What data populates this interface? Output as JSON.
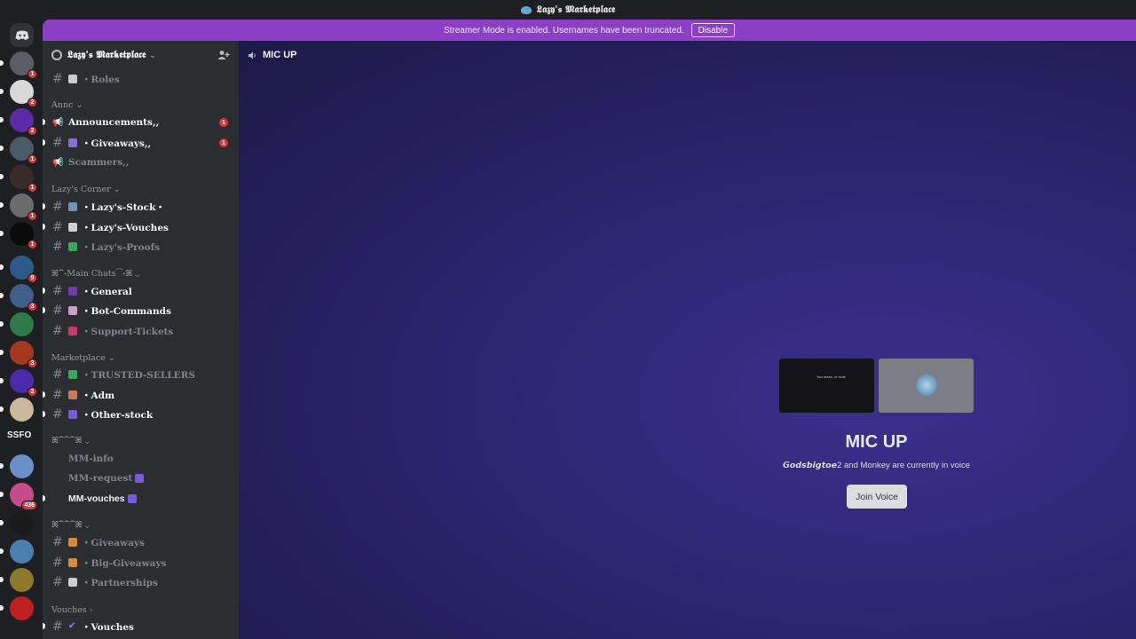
{
  "window": {
    "title": "𝕷𝖆𝖟𝖞'𝖘 𝕸𝖆𝖗𝖐𝖊𝖙𝖕𝖑𝖆𝖈𝖊"
  },
  "banner": {
    "text": "Streamer Mode is enabled. Usernames have been truncated.",
    "button": "Disable"
  },
  "guilds": [
    {
      "badge": "1",
      "color": "#5a5d64"
    },
    {
      "badge": "2",
      "color": "#d9d9d9"
    },
    {
      "badge": "2",
      "color": "#5a2aa8"
    },
    {
      "badge": "1",
      "color": "#4a5a66"
    },
    {
      "badge": "1",
      "color": "#3a2a2a"
    },
    {
      "badge": "1",
      "color": "#6b6b6b"
    },
    {
      "badge": "1",
      "color": "#0b0b0b"
    },
    {
      "badge": "9",
      "color": "#2d5a8a"
    },
    {
      "badge": "3",
      "color": "#3f5f8a"
    },
    {
      "badge": "",
      "color": "#2c7a4a"
    },
    {
      "badge": "3",
      "color": "#a33a20"
    },
    {
      "badge": "2",
      "color": "#4a2aa8"
    },
    {
      "badge": "",
      "color": "#c9b89a"
    },
    {
      "badge": "",
      "color": "#6b8fc7"
    },
    {
      "badge": "436",
      "color": "#c84a8a"
    },
    {
      "badge": "",
      "color": "#1a1a1a"
    },
    {
      "badge": "",
      "color": "#4a7fb0"
    },
    {
      "badge": "",
      "color": "#8a7a2a"
    },
    {
      "badge": "",
      "color": "#c02020"
    }
  ],
  "guild_text_ssfo": "SSFO",
  "server": {
    "name": "𝕷𝖆𝖟𝖞'𝖘 𝕸𝖆𝖗𝖐𝖊𝖙𝖕𝖑𝖆𝖈𝖊"
  },
  "channels": {
    "roles": "・Roles",
    "cat_annc": "Annc",
    "announcements": "Announcements,,",
    "giveaways_top": "・Giveaways,,",
    "scammers": "Scammers,,",
    "cat_corner": "Lazy's Corner",
    "stock": "・Lazy's-Stock・",
    "vouches_lazy": "・Lazy's-Vouches",
    "proofs": "・Lazy's-Proofs",
    "cat_main": "ꕤ⁀˖Main Chats⁀˖ꕤ",
    "general": "・General",
    "bot_commands": "・Bot-Commands",
    "support": "・Support-Tickets",
    "cat_market": "Marketplace",
    "trusted": "・TRUSTED-SELLERS",
    "adm": "・Adm",
    "other_stock": "・Other-stock",
    "cat_misc1": "ꕤ⁀⁀⁀ꕤ",
    "mm_info": "MM-info",
    "mm_request": "MM-request",
    "mm_vouches": "MM-vouches",
    "cat_misc2": "ꕤ⁀⁀⁀ꕤ",
    "giveaways": "・Giveaways",
    "big_giveaways": "・Big-Giveaways",
    "partnerships": "・Partnerships",
    "cat_vouches": "Vouches",
    "vouches": "・Vouches"
  },
  "mentions": {
    "announcements": "1",
    "giveaways": "1"
  },
  "voice": {
    "channel": "MIC UP",
    "title": "MIC UP",
    "user1": "𝙂𝙤𝙙𝙨𝙗𝙞𝙜𝙩𝙤𝙚",
    "sub_rest": "2 and Monkey are currently in voice",
    "preview_text": "You mean, or rude",
    "join": "Join Voice"
  }
}
